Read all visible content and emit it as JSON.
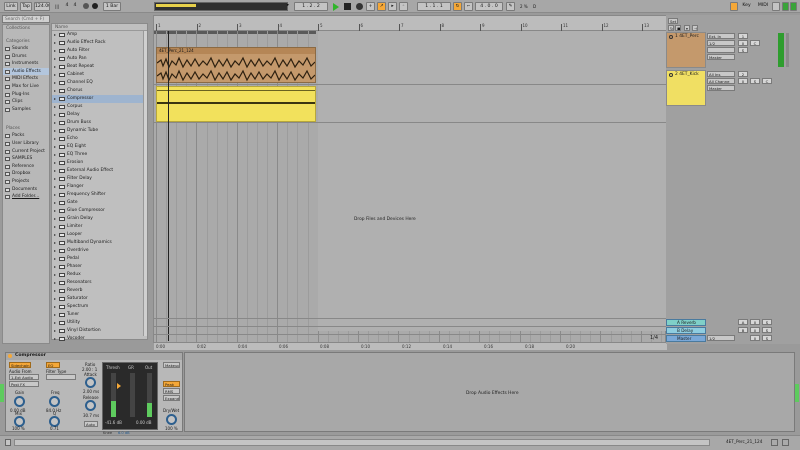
{
  "toolbar": {
    "link": "Link",
    "tap": "Tap",
    "tempo": "124.00",
    "sig_num": "4",
    "sig_den": "4",
    "quant": "1 Bar",
    "pos": "1 . 2 . 2",
    "loop_start": "1 . 1 . 1",
    "loop_len": "4 . 0 . 0",
    "cpu": "2 %",
    "key": "Key",
    "midi": "MIDI",
    "d": "D"
  },
  "sidebar": {
    "search": "Search (Cmd + F)",
    "collections_header": "Collections",
    "categories_header": "Categories",
    "categories": [
      "Sounds",
      "Drums",
      "Instruments",
      "Audio Effects",
      "MIDI Effects",
      "Max for Live",
      "Plug-Ins",
      "Clips",
      "Samples"
    ],
    "places_header": "Places",
    "places": [
      "Packs",
      "User Library",
      "Current Project",
      "SAMPLES",
      "Reference",
      "Dropbox",
      "Projects",
      "Documents",
      "Add Folder..."
    ]
  },
  "browser": {
    "name_header": "Name",
    "items": [
      "Amp",
      "Audio Effect Rack",
      "Auto Filter",
      "Auto Pan",
      "Beat Repeat",
      "Cabinet",
      "Channel EQ",
      "Chorus",
      "Compressor",
      "Corpus",
      "Delay",
      "Drum Buss",
      "Dynamic Tube",
      "Echo",
      "EQ Eight",
      "EQ Three",
      "Erosion",
      "External Audio Effect",
      "Filter Delay",
      "Flanger",
      "Frequency Shifter",
      "Gate",
      "Glue Compressor",
      "Grain Delay",
      "Limiter",
      "Looper",
      "Multiband Dynamics",
      "Overdrive",
      "Pedal",
      "Phaser",
      "Redux",
      "Resonators",
      "Reverb",
      "Saturator",
      "Spectrum",
      "Tuner",
      "Utility",
      "Vinyl Distortion",
      "Vocoder"
    ]
  },
  "arrangement": {
    "ruler": [
      "1",
      "2",
      "3",
      "4",
      "5",
      "6",
      "7",
      "8",
      "9",
      "10",
      "11",
      "12",
      "13"
    ],
    "clip1": "4ET_Perc_21_124",
    "drop": "Drop Files and Devices Here",
    "zoom": "1/4",
    "times": [
      "0:00",
      "0:02",
      "0:04",
      "0:06",
      "0:08",
      "0:10",
      "0:12",
      "0:14",
      "0:16",
      "0:18",
      "0:20"
    ]
  },
  "mixer": {
    "set": "Set",
    "tracks": [
      {
        "name": "1 4ET_Perc",
        "input": "Ext. In",
        "ch": "1/2",
        "mon": "Master",
        "vol": "0",
        "pan": "C",
        "s": "S",
        "num": "1"
      },
      {
        "name": "2 4ET_Kick",
        "input": "All Ins",
        "ch": "All Channe",
        "mon": "Master",
        "vol": "0",
        "pan": "C",
        "s": "S",
        "num": "2"
      }
    ],
    "returns": [
      {
        "name": "A Reverb",
        "letter": "A",
        "vol": "0",
        "pan": "C",
        "s": "S"
      },
      {
        "name": "B Delay",
        "letter": "B",
        "vol": "0",
        "pan": "C",
        "s": "S"
      },
      {
        "name": "Master",
        "letter": "",
        "vol": "0",
        "pan": "1/2",
        "s": "S"
      }
    ]
  },
  "device": {
    "title": "Compressor",
    "sidechain": "Sidechain",
    "eq": "EQ",
    "audio_from": "Audio From",
    "ext": "1-Ext Audio",
    "post": "Post FX",
    "filter_type": "Filter Type",
    "gain": "Gain",
    "gain_val": "0.00 dB",
    "freq": "Freq",
    "freq_val": "84.0 Hz",
    "mix": "Mix",
    "mix_val": "100 %",
    "q": "Q",
    "q_val": "0.71",
    "ratio": "Ratio",
    "ratio_val": "2.00 : 1",
    "attack": "Attack",
    "attack_val": "2.00 ms",
    "release": "Release",
    "release_val": "30.7 ms",
    "auto": "Auto",
    "thresh": "Thresh",
    "gr": "GR",
    "out": "Out",
    "thresh_val": "-41.6 dB",
    "out_val": "0.00 dB",
    "knee": "Knee",
    "knee_val": "6.0 dB",
    "lookahead": "Makeup",
    "peak": "Peak",
    "rms": "RMS",
    "expand": "Expand",
    "drywet": "Dry/Wet",
    "drywet_val": "100 %"
  },
  "drop2": "Drop Audio Effects Here",
  "status": {
    "clip": "4ET_Perc_21_124"
  }
}
